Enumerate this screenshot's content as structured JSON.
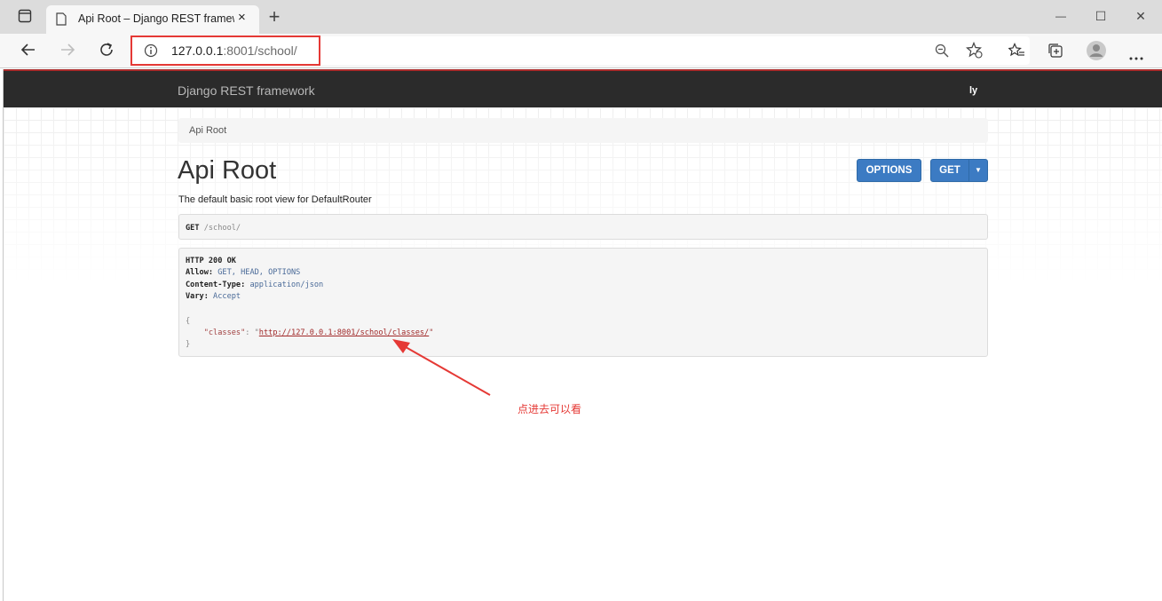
{
  "browser": {
    "tab_title": "Api Root – Django REST framewo",
    "tab_close": "×",
    "new_tab": "+",
    "url_host": "127.0.0.1",
    "url_rest": ":8001/school/",
    "window_controls": [
      "—",
      "☐",
      "✕"
    ]
  },
  "navbar": {
    "brand": "Django REST framework",
    "user": "ly"
  },
  "breadcrumb": "Api Root",
  "page": {
    "title": "Api Root",
    "description": "The default basic root view for DefaultRouter",
    "options_label": "OPTIONS",
    "get_label": "GET",
    "caret": "▼"
  },
  "request": {
    "method": "GET",
    "path": " /school/"
  },
  "response": {
    "status": "HTTP 200 OK",
    "allow_key": "Allow:",
    "allow_val": " GET, HEAD, OPTIONS",
    "ctype_key": "Content-Type:",
    "ctype_val": " application/json",
    "vary_key": "Vary:",
    "vary_val": " Accept",
    "open_brace": "{",
    "json_key": "    \"classes\"",
    "json_colon": ": \"",
    "json_url": "http://127.0.0.1:8001/school/classes/",
    "json_quote": "\"",
    "close_brace": "}"
  },
  "annotation": "点进去可以看",
  "colors": {
    "accent": "#3c7bc3",
    "navbar": "#2b2b2b",
    "annotation": "#e53935"
  }
}
